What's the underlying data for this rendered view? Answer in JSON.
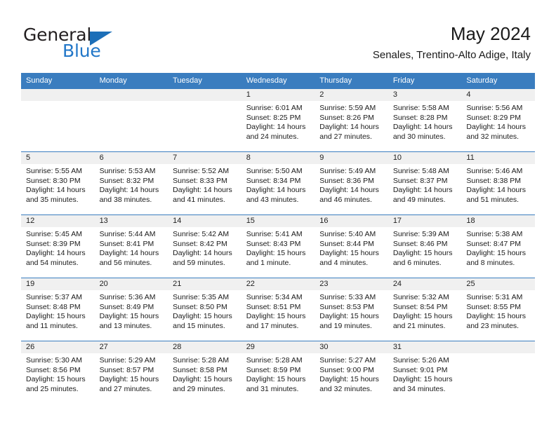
{
  "logo": {
    "word1": "General",
    "word2": "Blue",
    "accent_color": "#2277c8",
    "triangle_icon": "triangle-icon"
  },
  "header": {
    "month_title": "May 2024",
    "location": "Senales, Trentino-Alto Adige, Italy"
  },
  "calendar": {
    "header_bg": "#3a7dbf",
    "daynum_bg": "#f0f0f0",
    "weekdays": [
      "Sunday",
      "Monday",
      "Tuesday",
      "Wednesday",
      "Thursday",
      "Friday",
      "Saturday"
    ],
    "labels": {
      "sunrise": "Sunrise:",
      "sunset": "Sunset:",
      "daylight": "Daylight:"
    },
    "weeks": [
      [
        {
          "day": "",
          "empty": true
        },
        {
          "day": "",
          "empty": true
        },
        {
          "day": "",
          "empty": true
        },
        {
          "day": "1",
          "sunrise": "Sunrise: 6:01 AM",
          "sunset": "Sunset: 8:25 PM",
          "daylight_1": "Daylight: 14 hours",
          "daylight_2": "and 24 minutes."
        },
        {
          "day": "2",
          "sunrise": "Sunrise: 5:59 AM",
          "sunset": "Sunset: 8:26 PM",
          "daylight_1": "Daylight: 14 hours",
          "daylight_2": "and 27 minutes."
        },
        {
          "day": "3",
          "sunrise": "Sunrise: 5:58 AM",
          "sunset": "Sunset: 8:28 PM",
          "daylight_1": "Daylight: 14 hours",
          "daylight_2": "and 30 minutes."
        },
        {
          "day": "4",
          "sunrise": "Sunrise: 5:56 AM",
          "sunset": "Sunset: 8:29 PM",
          "daylight_1": "Daylight: 14 hours",
          "daylight_2": "and 32 minutes."
        }
      ],
      [
        {
          "day": "5",
          "sunrise": "Sunrise: 5:55 AM",
          "sunset": "Sunset: 8:30 PM",
          "daylight_1": "Daylight: 14 hours",
          "daylight_2": "and 35 minutes."
        },
        {
          "day": "6",
          "sunrise": "Sunrise: 5:53 AM",
          "sunset": "Sunset: 8:32 PM",
          "daylight_1": "Daylight: 14 hours",
          "daylight_2": "and 38 minutes."
        },
        {
          "day": "7",
          "sunrise": "Sunrise: 5:52 AM",
          "sunset": "Sunset: 8:33 PM",
          "daylight_1": "Daylight: 14 hours",
          "daylight_2": "and 41 minutes."
        },
        {
          "day": "8",
          "sunrise": "Sunrise: 5:50 AM",
          "sunset": "Sunset: 8:34 PM",
          "daylight_1": "Daylight: 14 hours",
          "daylight_2": "and 43 minutes."
        },
        {
          "day": "9",
          "sunrise": "Sunrise: 5:49 AM",
          "sunset": "Sunset: 8:36 PM",
          "daylight_1": "Daylight: 14 hours",
          "daylight_2": "and 46 minutes."
        },
        {
          "day": "10",
          "sunrise": "Sunrise: 5:48 AM",
          "sunset": "Sunset: 8:37 PM",
          "daylight_1": "Daylight: 14 hours",
          "daylight_2": "and 49 minutes."
        },
        {
          "day": "11",
          "sunrise": "Sunrise: 5:46 AM",
          "sunset": "Sunset: 8:38 PM",
          "daylight_1": "Daylight: 14 hours",
          "daylight_2": "and 51 minutes."
        }
      ],
      [
        {
          "day": "12",
          "sunrise": "Sunrise: 5:45 AM",
          "sunset": "Sunset: 8:39 PM",
          "daylight_1": "Daylight: 14 hours",
          "daylight_2": "and 54 minutes."
        },
        {
          "day": "13",
          "sunrise": "Sunrise: 5:44 AM",
          "sunset": "Sunset: 8:41 PM",
          "daylight_1": "Daylight: 14 hours",
          "daylight_2": "and 56 minutes."
        },
        {
          "day": "14",
          "sunrise": "Sunrise: 5:42 AM",
          "sunset": "Sunset: 8:42 PM",
          "daylight_1": "Daylight: 14 hours",
          "daylight_2": "and 59 minutes."
        },
        {
          "day": "15",
          "sunrise": "Sunrise: 5:41 AM",
          "sunset": "Sunset: 8:43 PM",
          "daylight_1": "Daylight: 15 hours",
          "daylight_2": "and 1 minute."
        },
        {
          "day": "16",
          "sunrise": "Sunrise: 5:40 AM",
          "sunset": "Sunset: 8:44 PM",
          "daylight_1": "Daylight: 15 hours",
          "daylight_2": "and 4 minutes."
        },
        {
          "day": "17",
          "sunrise": "Sunrise: 5:39 AM",
          "sunset": "Sunset: 8:46 PM",
          "daylight_1": "Daylight: 15 hours",
          "daylight_2": "and 6 minutes."
        },
        {
          "day": "18",
          "sunrise": "Sunrise: 5:38 AM",
          "sunset": "Sunset: 8:47 PM",
          "daylight_1": "Daylight: 15 hours",
          "daylight_2": "and 8 minutes."
        }
      ],
      [
        {
          "day": "19",
          "sunrise": "Sunrise: 5:37 AM",
          "sunset": "Sunset: 8:48 PM",
          "daylight_1": "Daylight: 15 hours",
          "daylight_2": "and 11 minutes."
        },
        {
          "day": "20",
          "sunrise": "Sunrise: 5:36 AM",
          "sunset": "Sunset: 8:49 PM",
          "daylight_1": "Daylight: 15 hours",
          "daylight_2": "and 13 minutes."
        },
        {
          "day": "21",
          "sunrise": "Sunrise: 5:35 AM",
          "sunset": "Sunset: 8:50 PM",
          "daylight_1": "Daylight: 15 hours",
          "daylight_2": "and 15 minutes."
        },
        {
          "day": "22",
          "sunrise": "Sunrise: 5:34 AM",
          "sunset": "Sunset: 8:51 PM",
          "daylight_1": "Daylight: 15 hours",
          "daylight_2": "and 17 minutes."
        },
        {
          "day": "23",
          "sunrise": "Sunrise: 5:33 AM",
          "sunset": "Sunset: 8:53 PM",
          "daylight_1": "Daylight: 15 hours",
          "daylight_2": "and 19 minutes."
        },
        {
          "day": "24",
          "sunrise": "Sunrise: 5:32 AM",
          "sunset": "Sunset: 8:54 PM",
          "daylight_1": "Daylight: 15 hours",
          "daylight_2": "and 21 minutes."
        },
        {
          "day": "25",
          "sunrise": "Sunrise: 5:31 AM",
          "sunset": "Sunset: 8:55 PM",
          "daylight_1": "Daylight: 15 hours",
          "daylight_2": "and 23 minutes."
        }
      ],
      [
        {
          "day": "26",
          "sunrise": "Sunrise: 5:30 AM",
          "sunset": "Sunset: 8:56 PM",
          "daylight_1": "Daylight: 15 hours",
          "daylight_2": "and 25 minutes."
        },
        {
          "day": "27",
          "sunrise": "Sunrise: 5:29 AM",
          "sunset": "Sunset: 8:57 PM",
          "daylight_1": "Daylight: 15 hours",
          "daylight_2": "and 27 minutes."
        },
        {
          "day": "28",
          "sunrise": "Sunrise: 5:28 AM",
          "sunset": "Sunset: 8:58 PM",
          "daylight_1": "Daylight: 15 hours",
          "daylight_2": "and 29 minutes."
        },
        {
          "day": "29",
          "sunrise": "Sunrise: 5:28 AM",
          "sunset": "Sunset: 8:59 PM",
          "daylight_1": "Daylight: 15 hours",
          "daylight_2": "and 31 minutes."
        },
        {
          "day": "30",
          "sunrise": "Sunrise: 5:27 AM",
          "sunset": "Sunset: 9:00 PM",
          "daylight_1": "Daylight: 15 hours",
          "daylight_2": "and 32 minutes."
        },
        {
          "day": "31",
          "sunrise": "Sunrise: 5:26 AM",
          "sunset": "Sunset: 9:01 PM",
          "daylight_1": "Daylight: 15 hours",
          "daylight_2": "and 34 minutes."
        },
        {
          "day": "",
          "empty": true
        }
      ]
    ]
  }
}
